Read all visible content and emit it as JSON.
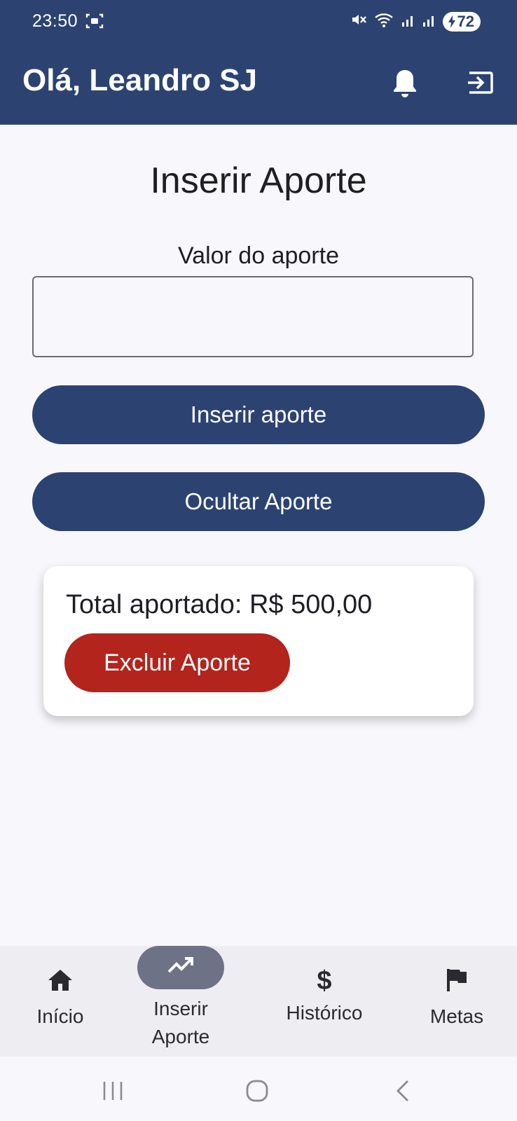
{
  "status_bar": {
    "time": "23:50",
    "battery": "72",
    "icons": [
      "screen-record-icon",
      "mute-icon",
      "wifi-icon",
      "signal-icon",
      "signal-icon",
      "battery-charging-icon"
    ]
  },
  "app_bar": {
    "greeting": "Olá, Leandro SJ",
    "icons": [
      "bell-icon",
      "logout-icon"
    ]
  },
  "main": {
    "title": "Inserir Aporte",
    "field_label": "Valor do aporte",
    "input_value": "",
    "insert_button": "Inserir aporte",
    "hide_button": "Ocultar Aporte"
  },
  "card": {
    "total": "Total aportado: R$ 500,00",
    "delete_button": "Excluir Aporte"
  },
  "bottom_nav": {
    "items": [
      {
        "label": "Início",
        "icon": "home-icon"
      },
      {
        "label_line1": "Inserir",
        "label_line2": "Aporte",
        "icon": "trending-up-icon",
        "active": true
      },
      {
        "label": "Histórico",
        "icon": "dollar-icon"
      },
      {
        "label": "Metas",
        "icon": "flag-icon"
      }
    ]
  },
  "colors": {
    "primary": "#2c4372",
    "danger": "#b3241d",
    "active_pill": "#6d7287",
    "background": "#f8f8fc"
  }
}
